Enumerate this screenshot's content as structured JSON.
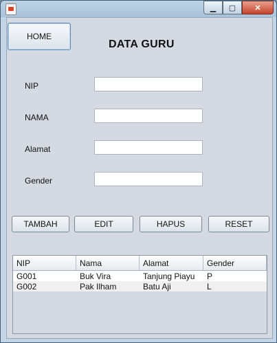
{
  "window": {
    "controls": {
      "minimize": "▁",
      "maximize": "▢",
      "close": "✕"
    },
    "icon": "java-app-icon"
  },
  "header": {
    "home_label": "HOME",
    "title": "DATA GURU"
  },
  "form": {
    "fields": [
      {
        "label": "NIP",
        "value": ""
      },
      {
        "label": "NAMA",
        "value": ""
      },
      {
        "label": "Alamat",
        "value": ""
      },
      {
        "label": "Gender",
        "value": ""
      }
    ]
  },
  "actions": {
    "tambah": "TAMBAH",
    "edit": "EDIT",
    "hapus": "HAPUS",
    "reset": "RESET"
  },
  "table": {
    "columns": [
      "NIP",
      "Nama",
      "Alamat",
      "Gender"
    ],
    "rows": [
      [
        "G001",
        "Buk Vira",
        "Tanjung Piayu",
        "P"
      ],
      [
        "G002",
        "Pak Ilham",
        "Batu Aji",
        "L"
      ]
    ]
  }
}
